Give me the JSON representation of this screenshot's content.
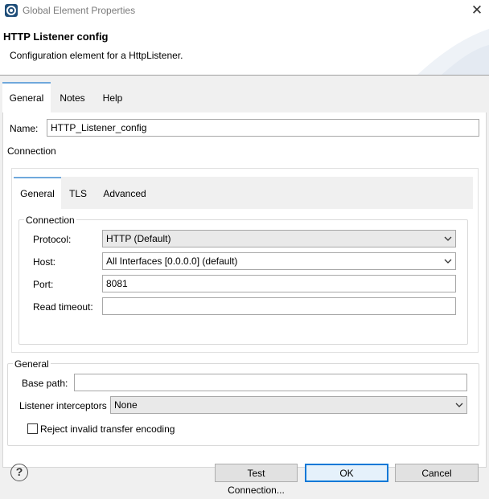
{
  "window": {
    "title": "Global Element Properties",
    "close_glyph": "✕"
  },
  "header": {
    "title": "HTTP Listener config",
    "description": "Configuration element for a HttpListener."
  },
  "outer_tabs": [
    {
      "label": "General",
      "active": true
    },
    {
      "label": "Notes",
      "active": false
    },
    {
      "label": "Help",
      "active": false
    }
  ],
  "name_field": {
    "label": "Name:",
    "value": "HTTP_Listener_config"
  },
  "connection_section": {
    "label": "Connection"
  },
  "inner_tabs": [
    {
      "label": "General",
      "active": true
    },
    {
      "label": "TLS",
      "active": false
    },
    {
      "label": "Advanced",
      "active": false
    }
  ],
  "connection_group": {
    "title": "Connection",
    "protocol": {
      "label": "Protocol:",
      "value": "HTTP (Default)"
    },
    "host": {
      "label": "Host:",
      "value": "All Interfaces [0.0.0.0] (default)"
    },
    "port": {
      "label": "Port:",
      "value": "8081"
    },
    "read_timeout": {
      "label": "Read timeout:",
      "value": ""
    }
  },
  "general_group": {
    "title": "General",
    "base_path": {
      "label": "Base path:",
      "value": ""
    },
    "listener_interceptors": {
      "label": "Listener interceptors",
      "value": "None"
    },
    "reject_invalid": {
      "label": "Reject invalid transfer encoding",
      "checked": false
    }
  },
  "footer": {
    "help_glyph": "?",
    "test_connection_label": "Test Connection...",
    "ok_label": "OK",
    "cancel_label": "Cancel"
  }
}
